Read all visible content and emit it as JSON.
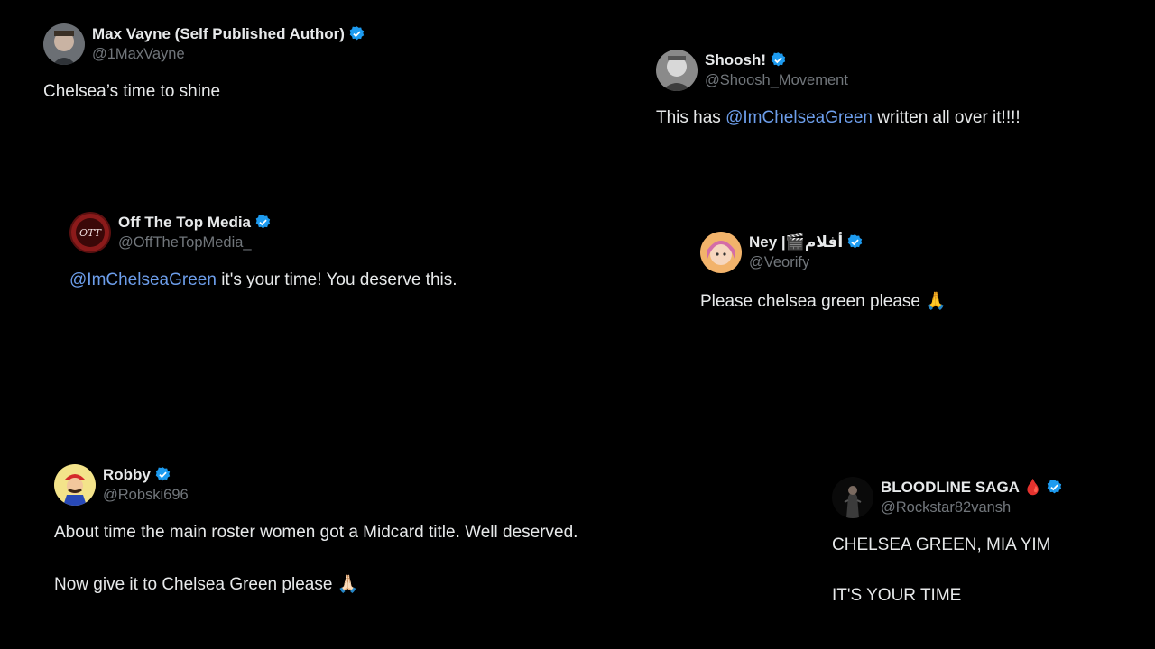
{
  "tweets": [
    {
      "name": "Max Vayne (Self Published Author)",
      "handle": "@1MaxVayne",
      "text": "Chelsea’s time to shine"
    },
    {
      "name": "Shoosh!",
      "handle": "@Shoosh_Movement",
      "text_before": "This has ",
      "mention": "@ImChelseaGreen",
      "text_after": " written all over it!!!!"
    },
    {
      "name": "Off The Top Media",
      "handle": "@OffTheTopMedia_",
      "mention": "@ImChelseaGreen",
      "text_after": " it's your time! You deserve this."
    },
    {
      "name": "Ney |🎬أفلام",
      "handle": "@Veorify",
      "text": "Please chelsea green please 🙏"
    },
    {
      "name": "Robby",
      "handle": "@Robski696",
      "line1": "About time the main roster women got a Midcard title. Well deserved.",
      "line2": "Now give it to Chelsea Green please 🙏🏻"
    },
    {
      "name": "BLOODLINE SAGA 🩸",
      "handle": "@Rockstar82vansh",
      "line1": "CHELSEA GREEN, MIA YIM",
      "line2": "IT'S YOUR TIME"
    }
  ],
  "colors": {
    "background": "#000000",
    "text": "#e7e9ea",
    "handle": "#71767b",
    "mention": "#6d9eeb",
    "verified": "#1d9bf0"
  },
  "icons": [
    "verified-badge-icon"
  ]
}
